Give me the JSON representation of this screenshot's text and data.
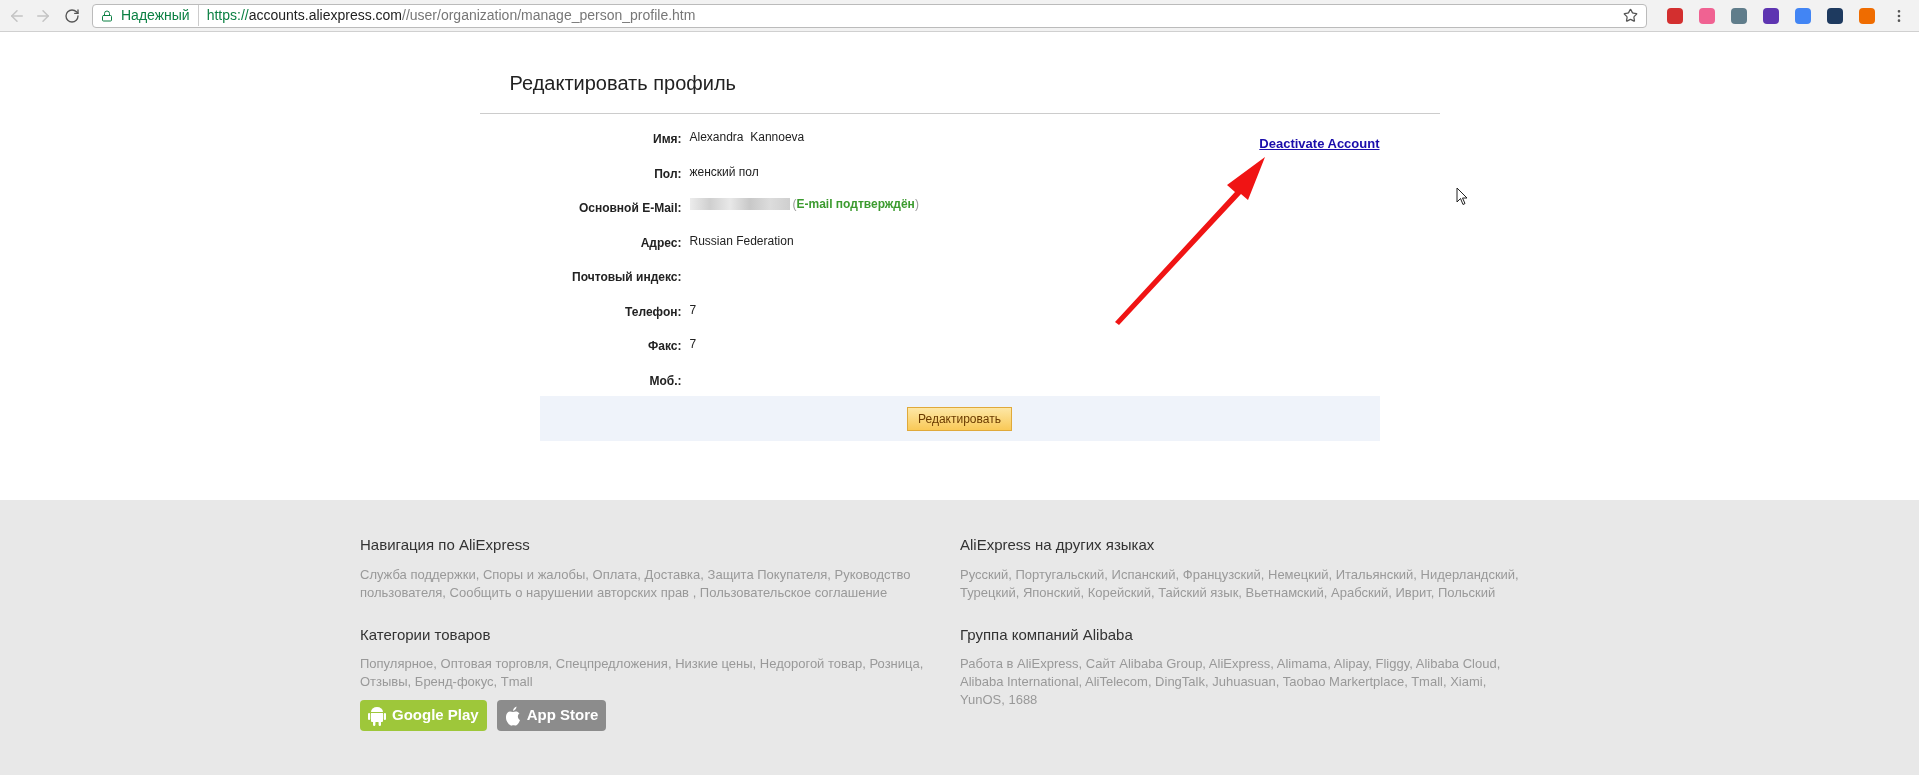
{
  "browser": {
    "security_label": "Надежный",
    "url_scheme": "https://",
    "url_host": "accounts.aliexpress.com",
    "url_path": "//user/organization/manage_person_profile.htm",
    "extensions": [
      {
        "color": "#d32f2f"
      },
      {
        "color": "#f06292"
      },
      {
        "color": "#607d8b"
      },
      {
        "color": "#5e35b1"
      },
      {
        "color": "#4285f4"
      },
      {
        "color": "#1e3a5f"
      },
      {
        "color": "#ef6c00"
      }
    ]
  },
  "page": {
    "title": "Редактировать профиль",
    "deactivate_link": "Deactivate Account",
    "fields": [
      {
        "kind": "text",
        "label": "Имя:",
        "value": "Alexandra  Kannoeva"
      },
      {
        "kind": "text",
        "label": "Пол:",
        "value": "женский пол"
      },
      {
        "kind": "email",
        "label": "Основной E-Mail:",
        "status": "(**E-mail подтверждён**)"
      },
      {
        "kind": "text",
        "label": "Адрес:",
        "value": "Russian Federation"
      },
      {
        "kind": "text",
        "label": "Почтовый индекс:"
      },
      {
        "kind": "text",
        "label": "Телефон:",
        "value": "7"
      },
      {
        "kind": "text",
        "label": "Факс:",
        "value": "7"
      },
      {
        "kind": "text",
        "label": "Моб.:"
      }
    ],
    "edit_button": "Редактировать"
  },
  "footer": {
    "columns": [
      {
        "sections": [
          {
            "heading": "Навигация по AliExpress",
            "links": "Служба поддержки, Споры и жалобы, Оплата, Доставка, Защита Покупателя, Руководство пользователя, Сообщить о нарушении авторских прав , Пользовательское соглашение"
          },
          {
            "heading": "Категории товаров",
            "links": "Популярное, Оптовая торговля, Спецпредложения, Низкие цены, Недорогой товар, Розница, Отзывы, Бренд-фокус, Tmall"
          }
        ],
        "app_buttons": [
          {
            "kind": "android",
            "label": "Google Play"
          },
          {
            "kind": "apple",
            "label": "App Store"
          }
        ]
      },
      {
        "sections": [
          {
            "heading": "AliExpress на других языках",
            "links": "Русский, Португальский, Испанский, Французский, Немецкий, Итальянский, Нидерландский, Турецкий, Японский, Корейский, Тайский язык, Вьетнамский, Арабский, Иврит, Польский"
          },
          {
            "heading": "Группа компаний Alibaba",
            "links": "Работа в AliExpress, Сайт Alibaba Group, AliExpress, Alimama, Alipay, Fliggy, Alibaba Cloud, Alibaba International, AliTelecom, DingTalk, Juhuasuan, Taobao Markertplace, Tmall, Xiami, YunOS, 1688"
          }
        ]
      }
    ]
  }
}
